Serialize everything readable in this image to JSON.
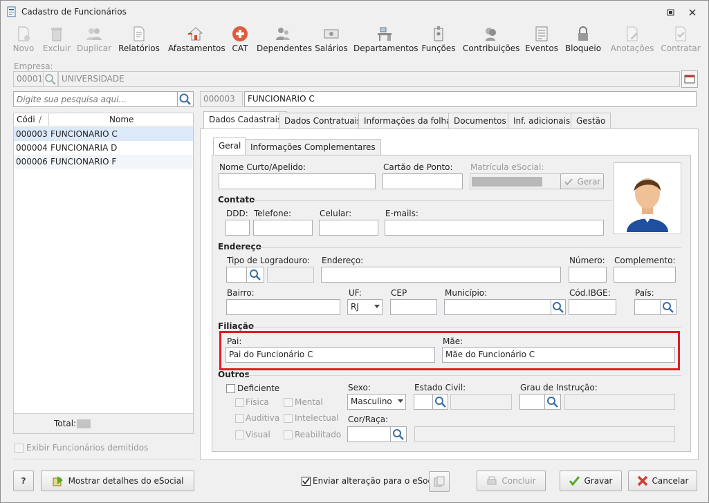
{
  "window": {
    "title": "Cadastro de Funcionários"
  },
  "toolbar": [
    {
      "label": "Novo",
      "enabled": false
    },
    {
      "label": "Excluir",
      "enabled": false
    },
    {
      "label": "Duplicar",
      "enabled": false
    },
    {
      "label": "Relatórios",
      "enabled": true
    },
    {
      "label": "Afastamentos",
      "enabled": true
    },
    {
      "label": "CAT",
      "enabled": true
    },
    {
      "label": "Dependentes",
      "enabled": true
    },
    {
      "label": "Salários",
      "enabled": true
    },
    {
      "label": "Departamentos",
      "enabled": true
    },
    {
      "label": "Funções",
      "enabled": true
    },
    {
      "label": "Contribuições",
      "enabled": true
    },
    {
      "label": "Eventos",
      "enabled": true
    },
    {
      "label": "Bloqueio",
      "enabled": true
    },
    {
      "label": "Anotações",
      "enabled": false
    },
    {
      "label": "Contratar",
      "enabled": false
    }
  ],
  "empresa": {
    "label": "Empresa:",
    "code": "00001",
    "name": "UNIVERSIDADE"
  },
  "search": {
    "placeholder": "Digite sua pesquisa aqui..."
  },
  "employee": {
    "code": "000003",
    "name": "FUNCIONARIO C"
  },
  "list": {
    "columns": [
      "Códi",
      "Nome"
    ],
    "rows": [
      [
        "000003",
        "FUNCIONARIO C"
      ],
      [
        "000004",
        "FUNCIONARIA D"
      ],
      [
        "000006",
        "FUNCIONARIO F"
      ]
    ],
    "total_label": "Total:",
    "show_dismissed": "Exibir Funcionários demitidos"
  },
  "tabs": [
    "Dados Cadastrais",
    "Dados Contratuais",
    "Informações da folha",
    "Documentos",
    "Inf. adicionais",
    "Gestão"
  ],
  "subtabs": [
    "Geral",
    "Informações Complementares"
  ],
  "form": {
    "nome_curto": "Nome Curto/Apelido:",
    "cartao": "Cartão de Ponto:",
    "matricula": "Matrícula eSocial:",
    "gerar": "Gerar",
    "contato": "Contato",
    "ddd": "DDD:",
    "telefone": "Telefone:",
    "celular": "Celular:",
    "emails": "E-mails:",
    "endereco_grp": "Endereço",
    "tipo_logradouro": "Tipo de Logradouro:",
    "endereco": "Endereço:",
    "numero": "Número:",
    "complemento": "Complemento:",
    "bairro": "Bairro:",
    "uf": "UF:",
    "uf_value": "RJ",
    "cep": "CEP",
    "municipio": "Município:",
    "cod_ibge": "Cód.IBGE:",
    "pais": "País:",
    "filiacao": "Filiação",
    "pai": "Pai:",
    "pai_value": "Pai do Funcionário C",
    "mae": "Mãe:",
    "mae_value": "Mãe do Funcionário C",
    "outros": "Outros",
    "deficiente": "Deficiente",
    "fisica": "Física",
    "mental": "Mental",
    "auditiva": "Auditiva",
    "intelectual": "Intelectual",
    "visual": "Visual",
    "reabilitado": "Reabilitado",
    "sexo": "Sexo:",
    "sexo_value": "Masculino",
    "estado_civil": "Estado Civil:",
    "grau_instrucao": "Grau de Instrução:",
    "cor_raca": "Cor/Raça:"
  },
  "footer": {
    "help": "?",
    "esocial_details": "Mostrar detalhes do eSocial",
    "send_esocial": "Enviar alteração para o eSocial",
    "concluir": "Concluir",
    "gravar": "Gravar",
    "cancelar": "Cancelar"
  },
  "colors": {
    "highlight": "#e01c24",
    "selected_row": "#dbe9f9",
    "cancel_icon": "#d83b2b",
    "save_icon": "#5aa829"
  }
}
